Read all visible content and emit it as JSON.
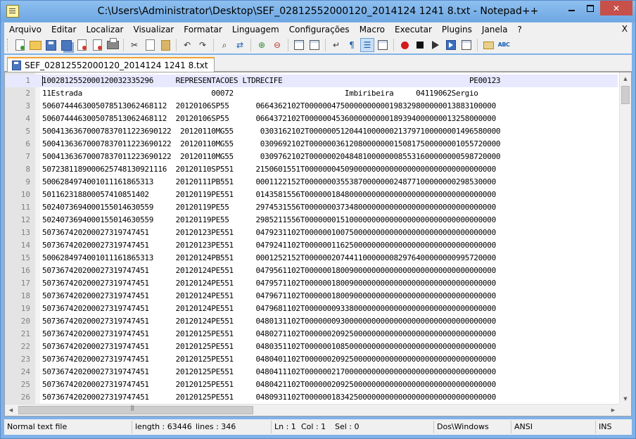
{
  "window": {
    "title": "C:\\Users\\Administrator\\Desktop\\SEF_02812552000120_2014124 1241 8.txt - Notepad++",
    "controls": {
      "minimize": "",
      "maximize": "",
      "close": "✕"
    }
  },
  "menu": {
    "items": [
      "Arquivo",
      "Editar",
      "Localizar",
      "Visualizar",
      "Formatar",
      "Linguagem",
      "Configurações",
      "Macro",
      "Executar",
      "Plugins",
      "Janela",
      "?"
    ],
    "close": "X"
  },
  "toolbar": {
    "icons": [
      "new-file-icon",
      "open-file-icon",
      "save-icon",
      "save-all-icon",
      "close-file-icon",
      "close-all-icon",
      "print-icon",
      "cut-icon",
      "copy-icon",
      "paste-icon",
      "undo-icon",
      "redo-icon",
      "find-icon",
      "replace-icon",
      "zoom-in-icon",
      "zoom-out-icon",
      "sync-vertical-icon",
      "sync-horizontal-icon",
      "word-wrap-icon",
      "show-all-chars-icon",
      "indent-guide-icon",
      "doc-map-icon",
      "record-macro-icon",
      "stop-record-icon",
      "playback-icon",
      "run-macro-multiple-icon",
      "save-macro-icon",
      "mail-icon",
      "spellcheck-icon"
    ],
    "spellcheck_text": "ABC"
  },
  "tabs": [
    {
      "label": "SEF_02812552000120_2014124 1241 8.txt",
      "active": true
    }
  ],
  "editor": {
    "current_line": 1,
    "lines": [
      {
        "n": "1",
        "text": "10028125520001200323352​96     REPRESENTACOES LTDRECIFE                                          PE00123"
      },
      {
        "n": "2",
        "text": "11Estrada                             00072                         Imbiribeira     04119062Sergio"
      },
      {
        "n": "3",
        "text": "50607444630050785130624681​12  20120106SP55      0664362102T0000004750000000000198329800000013883100000"
      },
      {
        "n": "4",
        "text": "50607444630050785130624681​12  20120106SP55      0664372102T0000004536000000000189394000000013258000000"
      },
      {
        "n": "5",
        "text": "50041363670007837011223690122  20120110MG55      0303162102T0000005120441000000213797100000001496580000"
      },
      {
        "n": "6",
        "text": "50041363670007837011223690122  20120110MG55      0309692102T0000003612080000000150817500000001055720000"
      },
      {
        "n": "7",
        "text": "50041363670007837011223690122  20120110MG55      0309762102T0000002048481000000085531600000000598720000"
      },
      {
        "n": "8",
        "text": "50723811890006257481309211​16  20120110SP551     2150601551T0000000450900000000000000000000000000000000"
      },
      {
        "n": "9",
        "text": "50062849740010111618653​13     20120111PB551     0001122152T0000000355387000000024877100000000298530000"
      },
      {
        "n": "10",
        "text": "50116231880005741085140​2      20120119PE551     0143581556T0000001848000000000000000000000000000000000"
      },
      {
        "n": "11",
        "text": "50240736940001550146305​59     20120119PE55      2974531556T0000000373480000000000000000000000000000000"
      },
      {
        "n": "12",
        "text": "50240736940001550146305​59     20120119PE55      2985211556T0000000151000000000000000000000000000000000"
      },
      {
        "n": "13",
        "text": "50736742020002731974745​1      20120123PE551     0479231102T0000001007500000000000000000000000000000000"
      },
      {
        "n": "14",
        "text": "50736742020002731974745​1      20120123PE551     0479241102T0000001162500000000000000000000000000000000"
      },
      {
        "n": "15",
        "text": "50062849740010111618653​13     20120124PB551     0001252152T0000002074411000000082976400000000995720000"
      },
      {
        "n": "16",
        "text": "50736742020002731974745​1      20120124PE551     0479561102T0000001800900000000000000000000000000000000"
      },
      {
        "n": "17",
        "text": "50736742020002731974745​1      20120124PE551     0479571102T0000001800900000000000000000000000000000000"
      },
      {
        "n": "18",
        "text": "50736742020002731974745​1      20120124PE551     0479671102T0000001800900000000000000000000000000000000"
      },
      {
        "n": "19",
        "text": "50736742020002731974745​1      20120124PE551     0479681102T0000000933800000000000000000000000000000000"
      },
      {
        "n": "20",
        "text": "50736742020002731974745​1      20120124PE551     0480131102T0000000930000000000000000000000000000000000"
      },
      {
        "n": "21",
        "text": "50736742020002731974745​1      20120125PE551     0480271102T0000002092500000000000000000000000000000000"
      },
      {
        "n": "22",
        "text": "50736742020002731974745​1      20120125PE551     0480351102T0000001085000000000000000000000000000000000"
      },
      {
        "n": "23",
        "text": "50736742020002731974745​1      20120125PE551     0480401102T0000002092500000000000000000000000000000000"
      },
      {
        "n": "24",
        "text": "50736742020002731974745​1      20120125PE551     0480411102T0000002170000000000000000000000000000000000"
      },
      {
        "n": "25",
        "text": "50736742020002731974745​1      20120125PE551     0480421102T0000002092500000000000000000000000000000000"
      },
      {
        "n": "26",
        "text": "50736742020002731974745​1      20120125PE551     0480931102T0000001834250000000000000000000000000000000"
      }
    ]
  },
  "statusbar": {
    "file_type": "Normal text file",
    "length": "length : 63446",
    "lines": "lines : 346",
    "ln": "Ln : 1",
    "col": "Col : 1",
    "sel": "Sel : 0",
    "eol": "Dos\\Windows",
    "encoding": "ANSI",
    "mode": "INS"
  }
}
